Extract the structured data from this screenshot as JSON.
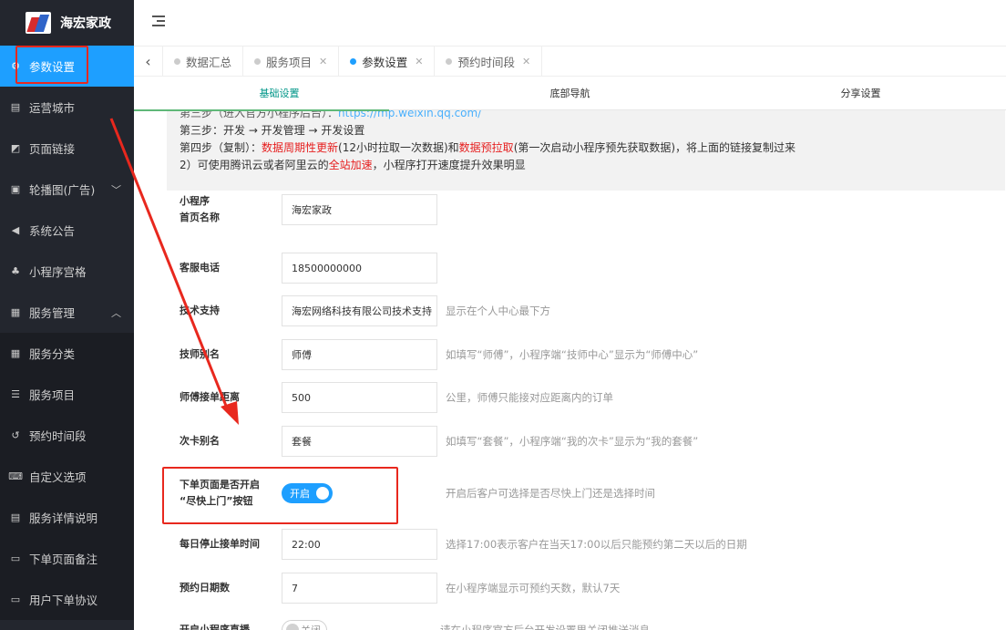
{
  "app": {
    "logo_text": "海宏家政"
  },
  "sidebar": {
    "items": [
      {
        "label": "参数设置",
        "icon": "gear-icon"
      },
      {
        "label": "运营城市",
        "icon": "clipboard-icon"
      },
      {
        "label": "页面链接",
        "icon": "link-icon"
      },
      {
        "label": "轮播图(广告)",
        "icon": "image-icon"
      },
      {
        "label": "系统公告",
        "icon": "speaker-icon"
      },
      {
        "label": "小程序宫格",
        "icon": "grid-sitemap-icon"
      },
      {
        "label": "服务管理",
        "icon": "list-icon"
      },
      {
        "label": "服务分类",
        "icon": "grid-icon"
      },
      {
        "label": "服务项目",
        "icon": "list-bullets-icon"
      },
      {
        "label": "预约时间段",
        "icon": "history-icon"
      },
      {
        "label": "自定义选项",
        "icon": "keyboard-icon"
      },
      {
        "label": "服务详情说明",
        "icon": "document-icon"
      },
      {
        "label": "下单页面备注",
        "icon": "note-icon"
      },
      {
        "label": "用户下单协议",
        "icon": "agreement-icon"
      }
    ]
  },
  "tabs": [
    {
      "label": "数据汇总"
    },
    {
      "label": "服务项目"
    },
    {
      "label": "参数设置"
    },
    {
      "label": "预约时间段"
    }
  ],
  "subtabs": [
    "基础设置",
    "底部导航",
    "分享设置"
  ],
  "tips": {
    "line1_prefix": "第三步（进入官方小程序后台）：",
    "line1_link": "https://mp.weixin.qq.com/",
    "line2": "第三步：开发 → 开发管理 → 开发设置",
    "line3_a": "第四步（复制）：",
    "line3_red1": "数据周期性更新",
    "line3_b": "(12小时拉取一次数据)和",
    "line3_red2": "数据预拉取",
    "line3_c": "(第一次启动小程序预先获取数据)，将上面的链接复制过来",
    "line4_a": "2）可使用腾讯云或者阿里云的",
    "line4_red": "全站加速",
    "line4_b": "，小程序打开速度提升效果明显"
  },
  "form": {
    "name_label_1": "小程序",
    "name_label_2": "首页名称",
    "name_value": "海宏家政",
    "phone_label": "客服电话",
    "phone_value": "18500000000",
    "support_label": "技术支持",
    "support_value": "海宏网络科技有限公司技术支持",
    "support_hint": "显示在个人中心最下方",
    "tech_label": "技师别名",
    "tech_value": "师傅",
    "tech_hint": "如填写“师傅”，小程序端“技师中心”显示为“师傅中心”",
    "distance_label": "师傅接单距离",
    "distance_value": "500",
    "distance_hint": "公里，师傅只能接对应距离内的订单",
    "card_label": "次卡别名",
    "card_value": "套餐",
    "card_hint": "如填写“套餐”，小程序端“我的次卡”显示为“我的套餐”",
    "asap_label_1": "下单页面是否开启",
    "asap_label_2": "“尽快上门”按钮",
    "asap_switch": "开启",
    "asap_hint": "开启后客户可选择是否尽快上门还是选择时间",
    "stop_label": "每日停止接单时间",
    "stop_value": "22:00",
    "stop_hint": "选择17:00表示客户在当天17:00以后只能预约第二天以后的日期",
    "days_label": "预约日期数",
    "days_value": "7",
    "days_hint": "在小程序端显示可预约天数，默认7天",
    "last_label": "开启小程序直播",
    "last_switch": "关闭",
    "last_hint": "请在小程序官方后台开发设置里关闭推送消息"
  },
  "colors": {
    "accent": "#1e9fff",
    "sidebar_bg": "#23262e",
    "annotation": "#e8281e"
  }
}
